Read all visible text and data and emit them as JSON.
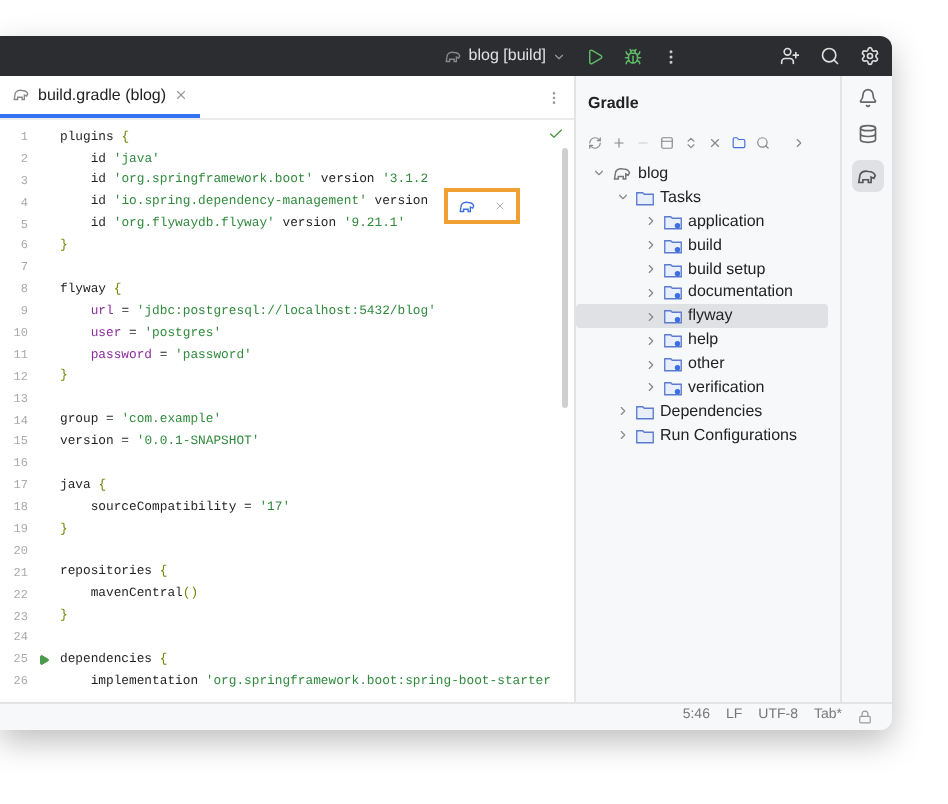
{
  "title_bar": {
    "project": "blog [build]"
  },
  "editor": {
    "tab": {
      "label": "build.gradle (blog)",
      "selected": true
    },
    "lines": [
      {
        "number": "1",
        "run": false,
        "segments": [
          {
            "kind": "plain",
            "text": "plugins "
          },
          {
            "kind": "punct",
            "text": "{"
          }
        ]
      },
      {
        "number": "2",
        "run": false,
        "segments": [
          {
            "kind": "plain",
            "text": "    id "
          },
          {
            "kind": "string",
            "text": "'java'"
          }
        ]
      },
      {
        "number": "3",
        "run": false,
        "segments": [
          {
            "kind": "plain",
            "text": "    id "
          },
          {
            "kind": "string",
            "text": "'org.springframework.boot'"
          },
          {
            "kind": "plain",
            "text": " version "
          },
          {
            "kind": "string",
            "text": "'3.1.2"
          }
        ]
      },
      {
        "number": "4",
        "run": false,
        "segments": [
          {
            "kind": "plain",
            "text": "    id "
          },
          {
            "kind": "string",
            "text": "'io.spring.dependency-management'"
          },
          {
            "kind": "plain",
            "text": " version"
          }
        ]
      },
      {
        "number": "5",
        "run": false,
        "segments": [
          {
            "kind": "plain",
            "text": "    id "
          },
          {
            "kind": "string",
            "text": "'org.flywaydb.flyway'"
          },
          {
            "kind": "plain",
            "text": " version "
          },
          {
            "kind": "string",
            "text": "'9.21.1'"
          }
        ]
      },
      {
        "number": "6",
        "run": false,
        "segments": [
          {
            "kind": "punct",
            "text": "}"
          }
        ]
      },
      {
        "number": "7",
        "run": false
      },
      {
        "number": "8",
        "run": false,
        "segments": [
          {
            "kind": "plain",
            "text": "flyway "
          },
          {
            "kind": "punct",
            "text": "{"
          }
        ]
      },
      {
        "number": "9",
        "run": false,
        "segments": [
          {
            "kind": "prop",
            "text": "    url"
          },
          {
            "kind": "plain",
            "text": " = "
          },
          {
            "kind": "string",
            "text": "'jdbc:postgresql://localhost:5432/blog'"
          }
        ]
      },
      {
        "number": "10",
        "run": false,
        "segments": [
          {
            "kind": "prop",
            "text": "    user"
          },
          {
            "kind": "plain",
            "text": " = "
          },
          {
            "kind": "string",
            "text": "'postgres'"
          }
        ]
      },
      {
        "number": "11",
        "run": false,
        "segments": [
          {
            "kind": "prop",
            "text": "    password"
          },
          {
            "kind": "plain",
            "text": " = "
          },
          {
            "kind": "string",
            "text": "'password'"
          }
        ]
      },
      {
        "number": "12",
        "run": false,
        "segments": [
          {
            "kind": "punct",
            "text": "}"
          }
        ]
      },
      {
        "number": "13",
        "run": false
      },
      {
        "number": "14",
        "run": false,
        "segments": [
          {
            "kind": "plain",
            "text": "group = "
          },
          {
            "kind": "string",
            "text": "'com.example'"
          }
        ]
      },
      {
        "number": "15",
        "run": false,
        "segments": [
          {
            "kind": "plain",
            "text": "version = "
          },
          {
            "kind": "string",
            "text": "'0.0.1-SNAPSHOT'"
          }
        ]
      },
      {
        "number": "16",
        "run": false
      },
      {
        "number": "17",
        "run": false,
        "segments": [
          {
            "kind": "plain",
            "text": "java "
          },
          {
            "kind": "punct",
            "text": "{"
          }
        ]
      },
      {
        "number": "18",
        "run": false,
        "segments": [
          {
            "kind": "plain",
            "text": "    sourceCompatibility = "
          },
          {
            "kind": "string",
            "text": "'17'"
          }
        ]
      },
      {
        "number": "19",
        "run": false,
        "segments": [
          {
            "kind": "punct",
            "text": "}"
          }
        ]
      },
      {
        "number": "20",
        "run": false
      },
      {
        "number": "21",
        "run": false,
        "segments": [
          {
            "kind": "plain",
            "text": "repositories "
          },
          {
            "kind": "punct",
            "text": "{"
          }
        ]
      },
      {
        "number": "22",
        "run": false,
        "segments": [
          {
            "kind": "plain",
            "text": "    mavenCentral"
          },
          {
            "kind": "punct",
            "text": "()"
          }
        ]
      },
      {
        "number": "23",
        "run": false,
        "segments": [
          {
            "kind": "punct",
            "text": "}"
          }
        ]
      },
      {
        "number": "24",
        "run": false
      },
      {
        "number": "25",
        "run": true,
        "segments": [
          {
            "kind": "plain",
            "text": "dependencies "
          },
          {
            "kind": "punct",
            "text": "{"
          }
        ]
      },
      {
        "number": "26",
        "run": false,
        "segments": [
          {
            "kind": "plain",
            "text": "    implementation "
          },
          {
            "kind": "string",
            "text": "'org.springframework.boot:spring-boot-starter"
          }
        ]
      }
    ]
  },
  "gradle": {
    "title": "Gradle",
    "tree": [
      {
        "label": "blog",
        "kind": "project",
        "expanded": true,
        "selected": false,
        "children": [
          {
            "label": "Tasks",
            "kind": "folder",
            "expanded": true,
            "selected": false,
            "children": [
              {
                "label": "application",
                "kind": "task",
                "expanded": false,
                "selected": false
              },
              {
                "label": "build",
                "kind": "task",
                "expanded": false,
                "selected": false
              },
              {
                "label": "build setup",
                "kind": "task",
                "expanded": false,
                "selected": false
              },
              {
                "label": "documentation",
                "kind": "task",
                "expanded": false,
                "selected": false
              },
              {
                "label": "flyway",
                "kind": "task",
                "expanded": false,
                "selected": true
              },
              {
                "label": "help",
                "kind": "task",
                "expanded": false,
                "selected": false
              },
              {
                "label": "other",
                "kind": "task",
                "expanded": false,
                "selected": false
              },
              {
                "label": "verification",
                "kind": "task",
                "expanded": false,
                "selected": false
              }
            ]
          },
          {
            "label": "Dependencies",
            "kind": "folder",
            "expanded": false,
            "selected": false
          },
          {
            "label": "Run Configurations",
            "kind": "folder",
            "expanded": false,
            "selected": false
          }
        ]
      }
    ]
  },
  "status_bar": [
    "5:46",
    "LF",
    "UTF-8",
    "Tab*"
  ]
}
